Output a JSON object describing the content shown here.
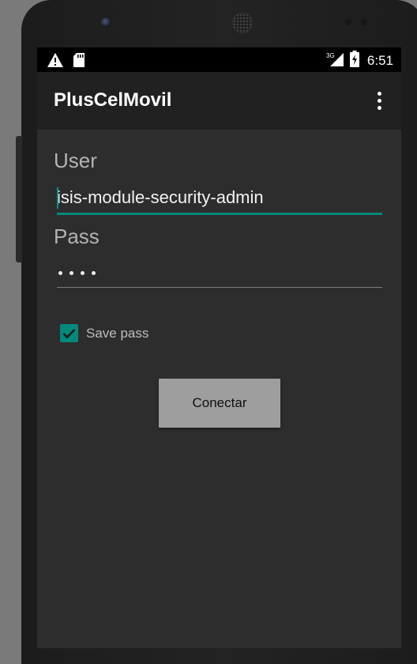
{
  "status_bar": {
    "network_type": "3G",
    "time": "6:51",
    "icons": [
      "warning-icon",
      "sd-card-icon",
      "signal-icon",
      "battery-charging-icon"
    ]
  },
  "app_bar": {
    "title": "PlusCelMovil",
    "overflow_icon": "more-vert-icon"
  },
  "form": {
    "user_label": "User",
    "user_value": "isis-module-security-admin",
    "pass_label": "Pass",
    "pass_masked_length": 4,
    "save_pass_label": "Save pass",
    "save_pass_checked": true,
    "connect_label": "Conectar"
  },
  "colors": {
    "accent": "#009688",
    "background": "#2d2d2d",
    "app_bar": "#212121",
    "button": "#9e9e9e"
  }
}
